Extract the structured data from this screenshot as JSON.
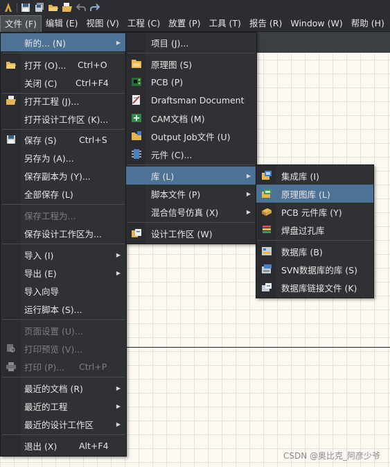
{
  "menubar": {
    "items": [
      {
        "label": "文件 (F)",
        "active": true
      },
      {
        "label": "编辑 (E)"
      },
      {
        "label": "视图 (V)"
      },
      {
        "label": "工程 (C)"
      },
      {
        "label": "放置 (P)"
      },
      {
        "label": "工具 (T)"
      },
      {
        "label": "报告 (R)"
      },
      {
        "label": "Window (W)"
      },
      {
        "label": "帮助 (H)"
      }
    ]
  },
  "file_menu": {
    "items": [
      {
        "label": "新的... (N)",
        "shortcut": ""
      },
      {
        "label": "打开 (O)...",
        "shortcut": "Ctrl+O"
      },
      {
        "label": "关闭 (C)",
        "shortcut": "Ctrl+F4"
      },
      {
        "label": "打开工程 (J)...",
        "shortcut": ""
      },
      {
        "label": "打开设计工作区 (K)...",
        "shortcut": ""
      },
      {
        "label": "保存 (S)",
        "shortcut": "Ctrl+S"
      },
      {
        "label": "另存为 (A)...",
        "shortcut": ""
      },
      {
        "label": "保存副本为 (Y)...",
        "shortcut": ""
      },
      {
        "label": "全部保存 (L)",
        "shortcut": ""
      },
      {
        "label": "保存工程为...",
        "shortcut": ""
      },
      {
        "label": "保存设计工作区为...",
        "shortcut": ""
      },
      {
        "label": "导入 (I)",
        "shortcut": ""
      },
      {
        "label": "导出 (E)",
        "shortcut": ""
      },
      {
        "label": "导入向导",
        "shortcut": ""
      },
      {
        "label": "运行脚本 (S)...",
        "shortcut": ""
      },
      {
        "label": "页面设置 (U)...",
        "shortcut": ""
      },
      {
        "label": "打印预览 (V)...",
        "shortcut": ""
      },
      {
        "label": "打印 (P)...",
        "shortcut": "Ctrl+P"
      },
      {
        "label": "最近的文档 (R)",
        "shortcut": ""
      },
      {
        "label": "最近的工程",
        "shortcut": ""
      },
      {
        "label": "最近的设计工作区",
        "shortcut": ""
      },
      {
        "label": "退出 (X)",
        "shortcut": "Alt+F4"
      }
    ]
  },
  "new_menu": {
    "items": [
      {
        "label": "项目 (J)...",
        "icon": "none"
      },
      {
        "label": "原理图 (S)",
        "icon": "schematic-icon"
      },
      {
        "label": "PCB (P)",
        "icon": "pcb-icon"
      },
      {
        "label": "Draftsman Document",
        "icon": "draftsman-icon"
      },
      {
        "label": "CAM文档 (M)",
        "icon": "cam-icon"
      },
      {
        "label": "Output Job文件 (U)",
        "icon": "output-job-icon"
      },
      {
        "label": "元件 (C)...",
        "icon": "component-icon"
      },
      {
        "label": "库 (L)",
        "icon": "none"
      },
      {
        "label": "脚本文件 (P)",
        "icon": "none"
      },
      {
        "label": "混合信号仿真 (X)",
        "icon": "none"
      },
      {
        "label": "设计工作区 (W)",
        "icon": "workspace-icon"
      }
    ]
  },
  "library_menu": {
    "items": [
      {
        "label": "集成库 (I)",
        "icon": "integrated-library-icon"
      },
      {
        "label": "原理图库 (L)",
        "icon": "schematic-library-icon"
      },
      {
        "label": "PCB 元件库 (Y)",
        "icon": "pcb-library-icon"
      },
      {
        "label": "焊盘过孔库",
        "icon": "pad-via-library-icon"
      },
      {
        "label": "数据库 (B)",
        "icon": "database-icon"
      },
      {
        "label": "SVN数据库的库 (S)",
        "icon": "svn-database-icon"
      },
      {
        "label": "数据库链接文件 (K)",
        "icon": "database-link-icon"
      }
    ]
  },
  "watermark": "CSDN @奥比克_阿彦少爷",
  "colors": {
    "menu_bg": "#2f3134",
    "highlight": "#4e7196",
    "disabled_text": "#7d7f82"
  }
}
